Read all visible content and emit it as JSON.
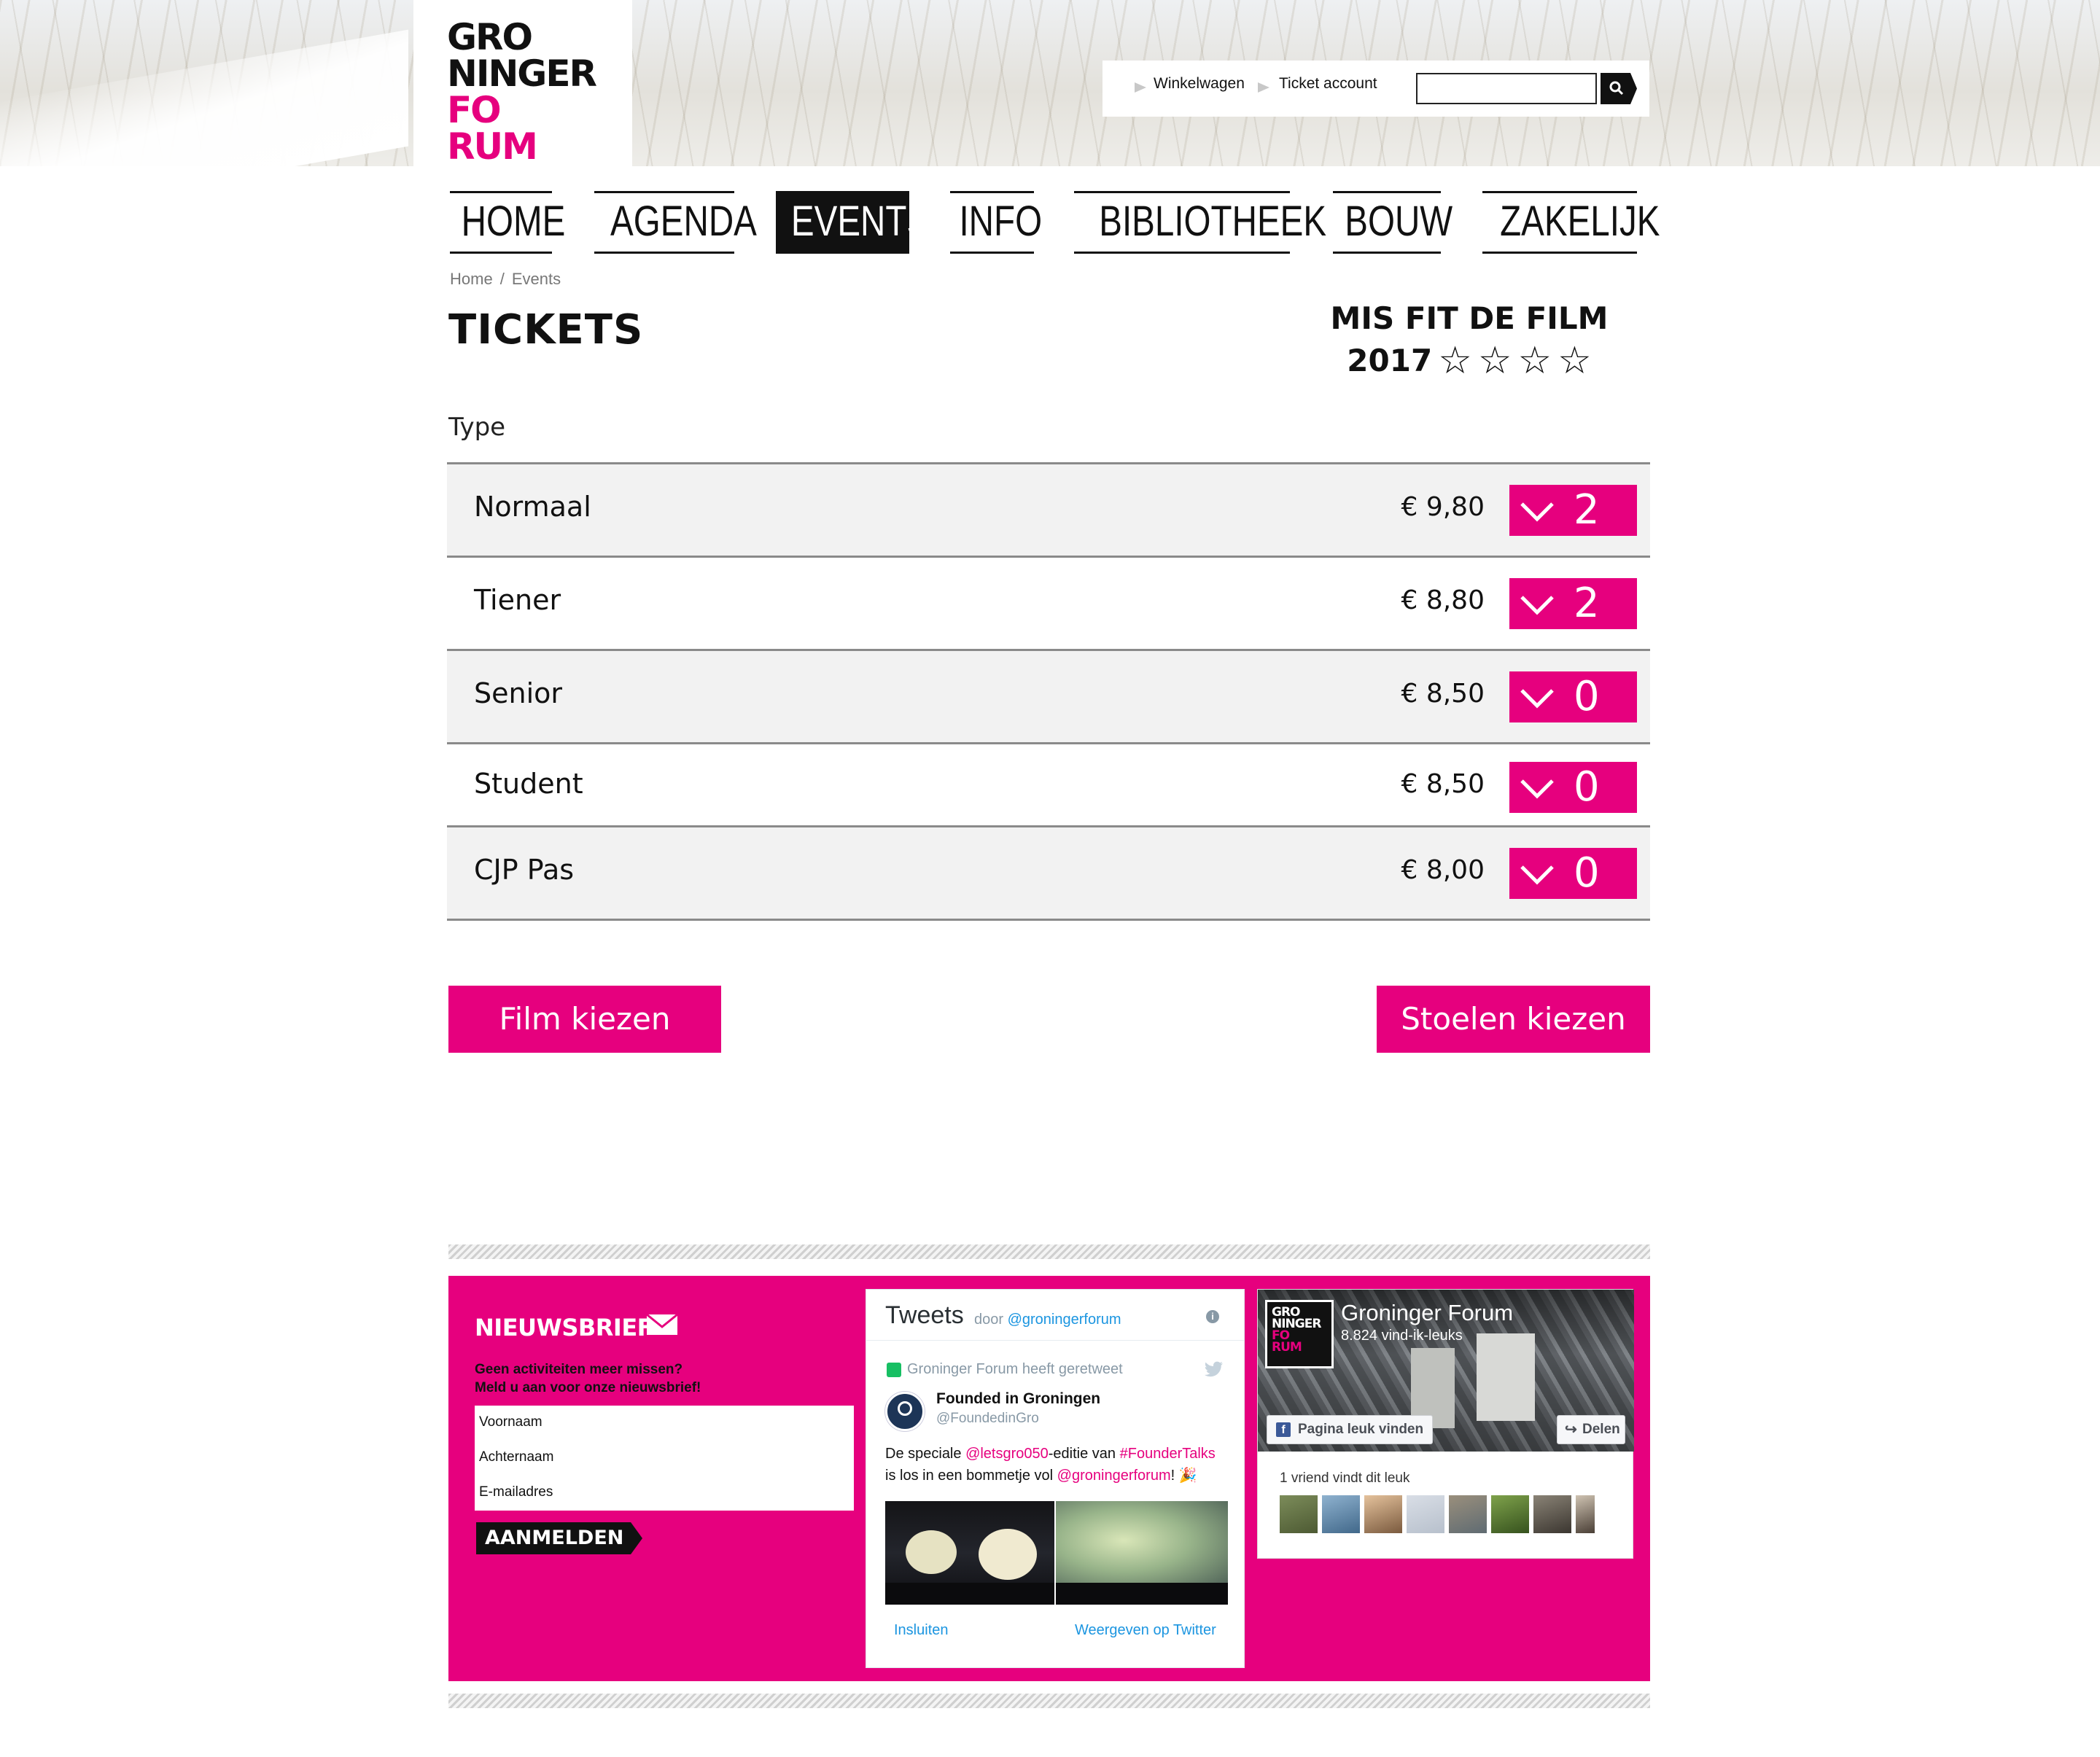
{
  "header": {
    "logo_lines": [
      "GRO",
      "NINGER",
      "FO",
      "RUM"
    ],
    "top_links": [
      "Winkelwagen",
      "Ticket account"
    ],
    "search": {
      "value": "",
      "placeholder": ""
    }
  },
  "nav": {
    "items": [
      {
        "label": "HOME",
        "active": false
      },
      {
        "label": "AGENDA",
        "active": false
      },
      {
        "label": "EVENTS",
        "active": true
      },
      {
        "label": "INFO",
        "active": false
      },
      {
        "label": "BIBLIOTHEEK",
        "active": false
      },
      {
        "label": "BOUW",
        "active": false
      },
      {
        "label": "ZAKELIJK",
        "active": false
      }
    ]
  },
  "breadcrumb": {
    "items": [
      "Home",
      "Events"
    ],
    "separator": "/"
  },
  "page": {
    "title": "TICKETS",
    "film": {
      "title": "MIS FIT DE FILM",
      "year": "2017",
      "rating": 0,
      "rating_max": 4
    },
    "type_label": "Type"
  },
  "tickets": [
    {
      "name": "Normaal",
      "price": "€ 9,80",
      "quantity": "2"
    },
    {
      "name": "Tiener",
      "price": "€ 8,80",
      "quantity": "2"
    },
    {
      "name": "Senior",
      "price": "€ 8,50",
      "quantity": "0"
    },
    {
      "name": "Student",
      "price": "€ 8,50",
      "quantity": "0"
    },
    {
      "name": "CJP Pas",
      "price": "€ 8,00",
      "quantity": "0"
    }
  ],
  "actions": {
    "back": "Film kiezen",
    "next": "Stoelen kiezen"
  },
  "newsletter": {
    "title": "NIEUWSBRIEF",
    "text_line1": "Geen activiteiten meer missen?",
    "text_line2": "Meld u aan voor onze nieuwsbrief!",
    "fields": [
      "Voornaam",
      "Achternaam",
      "E-mailadres"
    ],
    "submit": "AANMELDEN"
  },
  "twitter": {
    "title": "Tweets",
    "by_prefix": "door",
    "by_handle": "@groningerforum",
    "info": "i",
    "retweet_note": "Groninger Forum heeft geretweet",
    "author_name": "Founded in Groningen",
    "author_handle": "@FoundedinGro",
    "tweet": {
      "t1": "De speciale ",
      "mention1": "@letsgro050",
      "t2": "-editie van ",
      "hashtag": "#FounderTalks",
      "t3": " is los in een bommetje vol ",
      "mention2": "@groningerforum",
      "t4": "! 🎉"
    },
    "embed": "Insluiten",
    "view": "Weergeven op Twitter"
  },
  "facebook": {
    "page_name": "Groninger Forum",
    "likes": "8.824 vind-ik-leuks",
    "like_button": "Pagina leuk vinden",
    "share_button": "Delen",
    "friends_text": "1 vriend vindt dit leuk"
  },
  "colors": {
    "accent": "#e6007e",
    "text": "#111111",
    "row_shade": "#f2f2f2"
  }
}
